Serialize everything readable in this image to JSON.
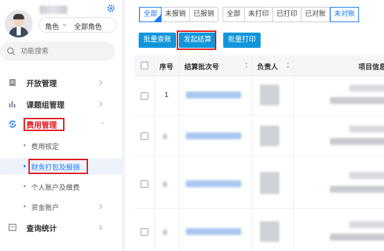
{
  "sidebar": {
    "role_label": "角色",
    "role_value": "全部角色",
    "search_placeholder": "功能搜索",
    "items": [
      {
        "label": "开放管理"
      },
      {
        "label": "课题组管理"
      },
      {
        "label": "费用管理"
      },
      {
        "label": "查询统计"
      }
    ],
    "sub_items": [
      {
        "label": "费用核定"
      },
      {
        "label": "财务打包及报销"
      },
      {
        "label": "个人账户及缴费"
      },
      {
        "label": "资金账户"
      }
    ]
  },
  "tabs": {
    "group1": [
      "全部",
      "未报销",
      "已报销"
    ],
    "group2": [
      "全部",
      "未打印",
      "已打印",
      "已对账",
      "未对账"
    ]
  },
  "toolbar": {
    "batch_check": "批量查账",
    "start_settle": "发起结算",
    "batch_print": "批量打印"
  },
  "table": {
    "columns": {
      "index": "序号",
      "batch_no": "结算批次号",
      "owner": "负责人",
      "project": "项目信息"
    },
    "first_row_index": "1"
  },
  "colors": {
    "accent": "#1677ff",
    "button": "#1296db",
    "highlight": "#e0161c"
  }
}
